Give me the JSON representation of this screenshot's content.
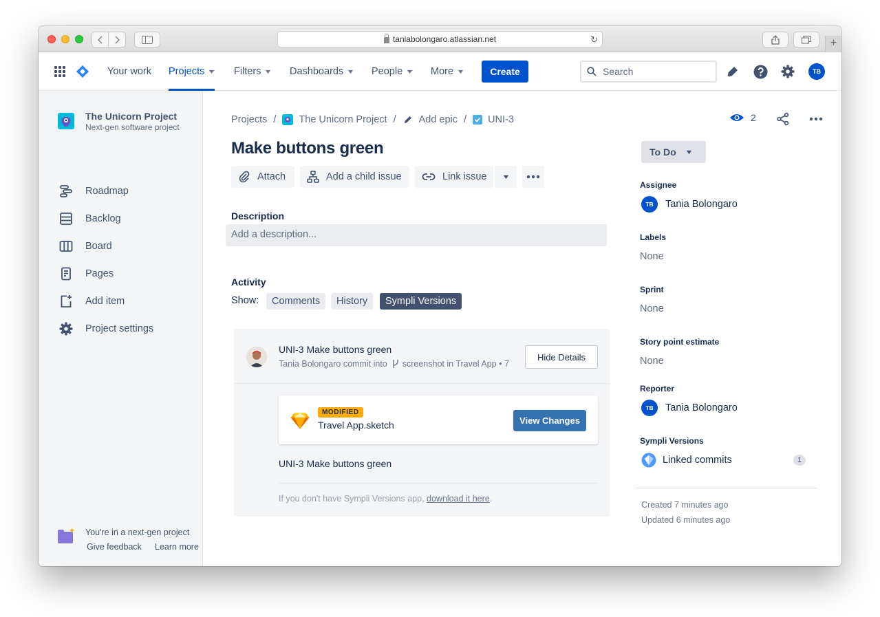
{
  "browser": {
    "url": "taniabolongaro.atlassian.net"
  },
  "nav": {
    "your_work": "Your work",
    "projects": "Projects",
    "filters": "Filters",
    "dashboards": "Dashboards",
    "people": "People",
    "more": "More",
    "create": "Create",
    "search_placeholder": "Search",
    "user_initials": "TB"
  },
  "sidebar": {
    "project_name": "The Unicorn Project",
    "project_type": "Next-gen software project",
    "items": [
      {
        "label": "Roadmap",
        "icon": "roadmap-icon"
      },
      {
        "label": "Backlog",
        "icon": "backlog-icon"
      },
      {
        "label": "Board",
        "icon": "board-icon"
      },
      {
        "label": "Pages",
        "icon": "pages-icon"
      },
      {
        "label": "Add item",
        "icon": "add-item-icon"
      },
      {
        "label": "Project settings",
        "icon": "gear-icon"
      }
    ],
    "footer": {
      "title": "You're in a next-gen project",
      "feedback": "Give feedback",
      "learn_more": "Learn more"
    }
  },
  "breadcrumb": {
    "projects": "Projects",
    "project": "The Unicorn Project",
    "epic": "Add epic",
    "issue_key": "UNI-3"
  },
  "watchers": "2",
  "issue": {
    "title": "Make buttons green",
    "toolbar": {
      "attach": "Attach",
      "add_child": "Add a child issue",
      "link_issue": "Link issue"
    },
    "description_label": "Description",
    "description_placeholder": "Add a description...",
    "activity_label": "Activity",
    "show_label": "Show:",
    "activity_tabs": [
      "Comments",
      "History",
      "Sympli Versions"
    ],
    "activity_selected": "Sympli Versions"
  },
  "sympli": {
    "commit_title": "UNI-3 Make buttons green",
    "commit_author": "Tania Bolongaro commit into",
    "commit_branch": "screenshot in Travel App • 7",
    "hide_details": "Hide Details",
    "file_badge": "MODIFIED",
    "file_name": "Travel App.sketch",
    "view_changes": "View Changes",
    "commit_message": "UNI-3 Make buttons green",
    "footer_text": "If you don't have Sympli Versions app, ",
    "footer_link": "download it here",
    "footer_end": "."
  },
  "details": {
    "status": "To Do",
    "assignee_label": "Assignee",
    "assignee": "Tania Bolongaro",
    "assignee_initials": "TB",
    "labels_label": "Labels",
    "labels_value": "None",
    "sprint_label": "Sprint",
    "sprint_value": "None",
    "story_points_label": "Story point estimate",
    "story_points_value": "None",
    "reporter_label": "Reporter",
    "reporter": "Tania Bolongaro",
    "reporter_initials": "TB",
    "sympli_label": "Sympli Versions",
    "linked_commits": "Linked commits",
    "linked_count": "1",
    "created": "Created 7 minutes ago",
    "updated": "Updated 6 minutes ago"
  },
  "colors": {
    "brand_blue": "#0052cc",
    "sympli_blue": "#3572b0",
    "badge_orange": "#ffab00",
    "selected_tab": "#42526e"
  }
}
